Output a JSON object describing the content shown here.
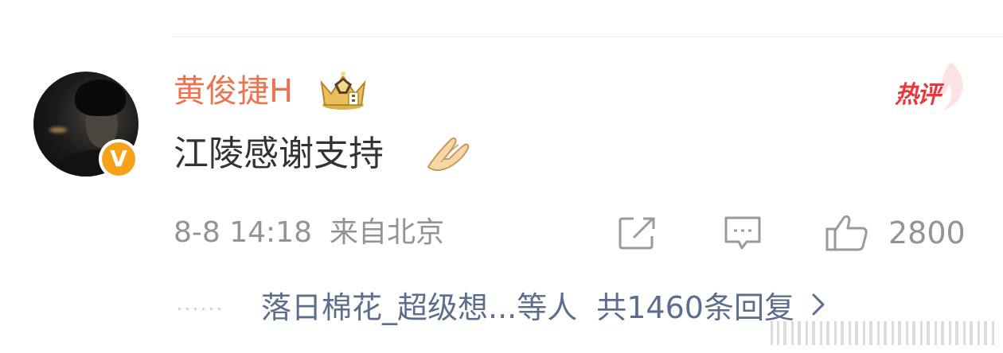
{
  "comment": {
    "username": "黄俊捷H",
    "text": "江陵感谢支持",
    "emoji": "praying-hands-emoji",
    "hot_badge": "热评",
    "verified_badge": "V",
    "time": "8-8 14:18",
    "location": "来自北京",
    "like_count": "2800"
  },
  "replies": {
    "preview": "落日棉花_超级想...等人",
    "total": "共1460条回复"
  },
  "colors": {
    "username": "#eb7350",
    "link": "#5d6d8c",
    "meta": "#939393",
    "hot": "#e8383d",
    "verified": "#f6a11a"
  },
  "icons": [
    "crown-badge-icon",
    "share-icon",
    "comment-icon",
    "like-icon",
    "chevron-right-icon"
  ]
}
